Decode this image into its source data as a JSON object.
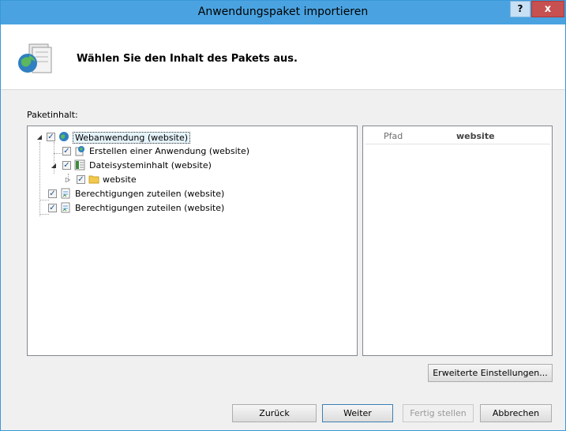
{
  "window": {
    "title": "Anwendungspaket importieren",
    "help_label": "?",
    "close_label": "x"
  },
  "header": {
    "heading": "Wählen Sie den Inhalt des Pakets aus."
  },
  "content": {
    "label": "Paketinhalt:"
  },
  "tree": {
    "nodes": [
      {
        "label": "Webanwendung (website)",
        "checked": true,
        "icon": "globe-icon",
        "expanded": true
      },
      {
        "label": "Erstellen einer Anwendung (website)",
        "checked": true,
        "icon": "create-application-icon"
      },
      {
        "label": "Dateisysteminhalt (website)",
        "checked": true,
        "icon": "file-system-icon",
        "expanded": true
      },
      {
        "label": "website",
        "checked": true,
        "icon": "folder-icon",
        "expanded": false
      },
      {
        "label": "Berechtigungen zuteilen (website)",
        "checked": true,
        "icon": "permissions-icon"
      },
      {
        "label": "Berechtigungen zuteilen (website)",
        "checked": true,
        "icon": "permissions-icon"
      }
    ]
  },
  "properties": {
    "key": "Pfad",
    "value": "website"
  },
  "buttons": {
    "advanced": "Erweiterte Einstellungen...",
    "back": "Zurück",
    "next": "Weiter",
    "finish": "Fertig stellen",
    "cancel": "Abbrechen"
  },
  "colors": {
    "titlebar": "#4aa3e0",
    "close": "#c75050",
    "accent": "#3c7fb1"
  }
}
